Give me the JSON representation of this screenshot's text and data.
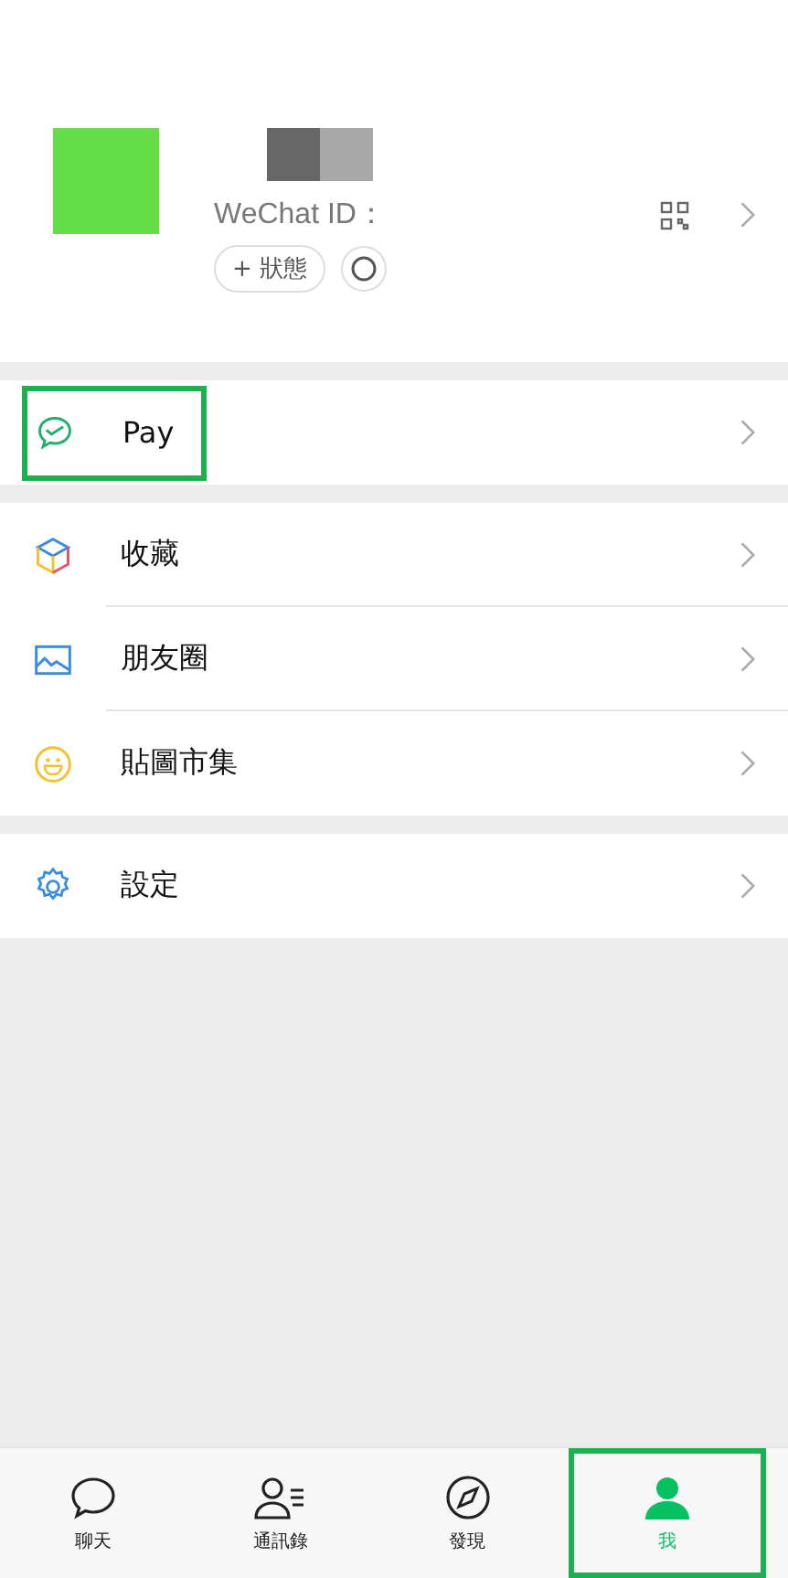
{
  "profile": {
    "id_label": "WeChat ID：",
    "status_button": "+ 狀態"
  },
  "menu_groups": [
    {
      "items": [
        {
          "kind": "pay",
          "label": "Pay",
          "highlighted": true
        }
      ]
    },
    {
      "items": [
        {
          "kind": "favorites",
          "label": "收藏",
          "highlighted": false
        },
        {
          "kind": "moments",
          "label": "朋友圈",
          "highlighted": false
        },
        {
          "kind": "stickers",
          "label": "貼圖市集",
          "highlighted": false
        }
      ]
    },
    {
      "items": [
        {
          "kind": "settings",
          "label": "設定",
          "highlighted": false
        }
      ]
    }
  ],
  "tabs": [
    {
      "kind": "chats",
      "label": "聊天",
      "selected": false,
      "highlighted": false
    },
    {
      "kind": "contacts",
      "label": "通訊錄",
      "selected": false,
      "highlighted": false
    },
    {
      "kind": "discover",
      "label": "發現",
      "selected": false,
      "highlighted": false
    },
    {
      "kind": "me",
      "label": "我",
      "selected": true,
      "highlighted": true
    }
  ]
}
